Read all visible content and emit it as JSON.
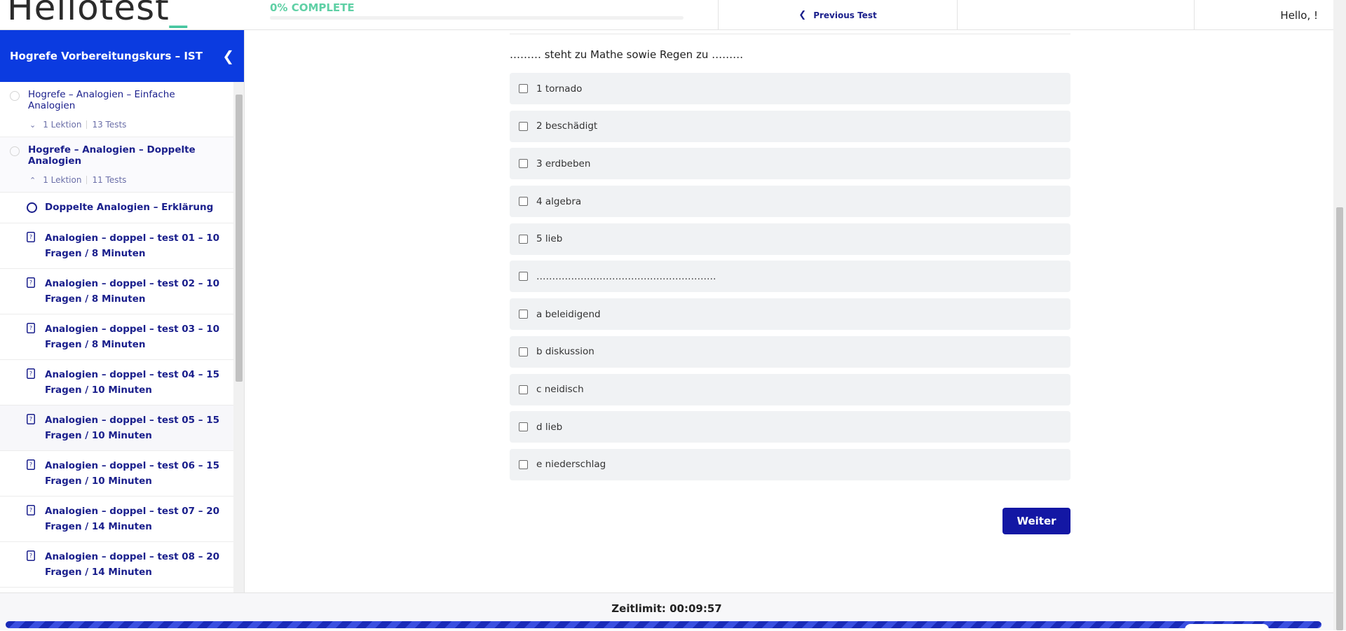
{
  "header": {
    "logo_text": "Hellotest",
    "logo_mark": "_",
    "progress_label": "0% COMPLETE",
    "progress_percent": 0,
    "previous_test_label": "Previous Test",
    "greeting": "Hello, !"
  },
  "sidebar": {
    "course_title": "Hogrefe Vorbereitungskurs – IST",
    "sections": [
      {
        "label": "Hogrefe – Analogien – Einfache Analogien",
        "lessons_count": "1 Lektion",
        "tests_count": "13 Tests",
        "expanded": false
      },
      {
        "label": "Hogrefe – Analogien – Doppelte Analogien",
        "lessons_count": "1 Lektion",
        "tests_count": "11 Tests",
        "expanded": true
      }
    ],
    "items": [
      {
        "label": "Doppelte Analogien – Erklärung",
        "icon": "circle-icon"
      },
      {
        "label": "Analogien – doppel – test 01 – 10 Fragen / 8 Minuten",
        "icon": "quiz-icon"
      },
      {
        "label": "Analogien – doppel – test 02 – 10 Fragen / 8 Minuten",
        "icon": "quiz-icon"
      },
      {
        "label": "Analogien – doppel – test 03 – 10 Fragen / 8 Minuten",
        "icon": "quiz-icon"
      },
      {
        "label": "Analogien – doppel – test 04 – 15 Fragen / 10 Minuten",
        "icon": "quiz-icon"
      },
      {
        "label": "Analogien – doppel – test 05 – 15 Fragen / 10 Minuten",
        "icon": "quiz-icon"
      },
      {
        "label": "Analogien – doppel – test 06 – 15 Fragen / 10 Minuten",
        "icon": "quiz-icon"
      },
      {
        "label": "Analogien – doppel – test 07 – 20 Fragen / 14 Minuten",
        "icon": "quiz-icon"
      },
      {
        "label": "Analogien – doppel – test 08 – 20 Fragen / 14 Minuten",
        "icon": "quiz-icon"
      }
    ]
  },
  "quiz": {
    "question": "……… steht zu Mathe sowie Regen zu ………",
    "options": [
      "1 tornado",
      "2 beschädigt",
      "3 erdbeben",
      "4 algebra",
      "5 lieb",
      "…………………………………………………",
      "a beleidigend",
      "b diskussion",
      "c neidisch",
      "d lieb",
      "e niederschlag"
    ],
    "next_label": "Weiter"
  },
  "footer": {
    "timer_label": "Zeitlimit: 00:09:57"
  },
  "colors": {
    "brand_blue": "#0b3be0",
    "accent_green": "#5fd0a5",
    "button_blue": "#1317a4",
    "link_navy": "#1a1f8c"
  }
}
